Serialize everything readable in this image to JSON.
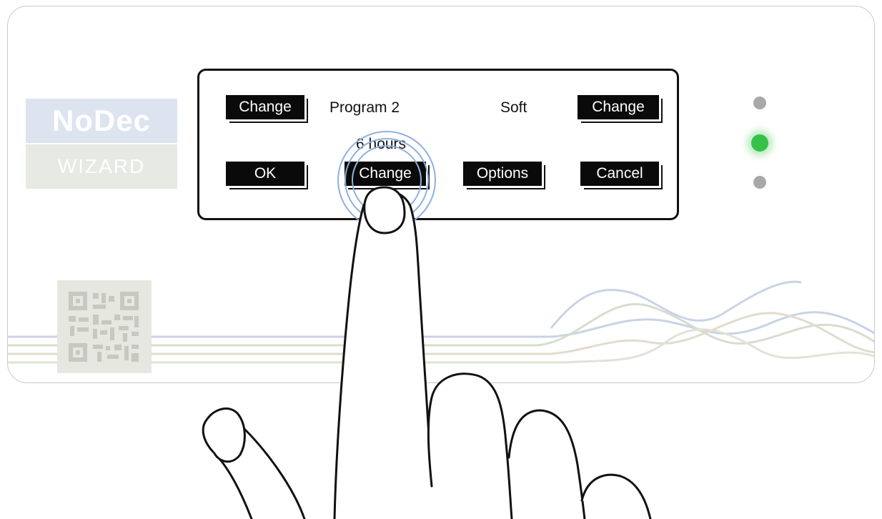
{
  "brand": {
    "name": "NoDec",
    "subtitle": "WIZARD"
  },
  "display": {
    "row1": {
      "left_button": "Change",
      "program": "Program 2",
      "mode": "Soft",
      "right_button": "Change"
    },
    "duration": "6 hours",
    "row2": {
      "ok_button": "OK",
      "change_button": "Change",
      "options_button": "Options",
      "cancel_button": "Cancel"
    }
  },
  "indicators": {
    "colors": {
      "off": "#a8a8a8",
      "on": "#36c24a"
    },
    "states": [
      "off",
      "on",
      "off"
    ]
  }
}
